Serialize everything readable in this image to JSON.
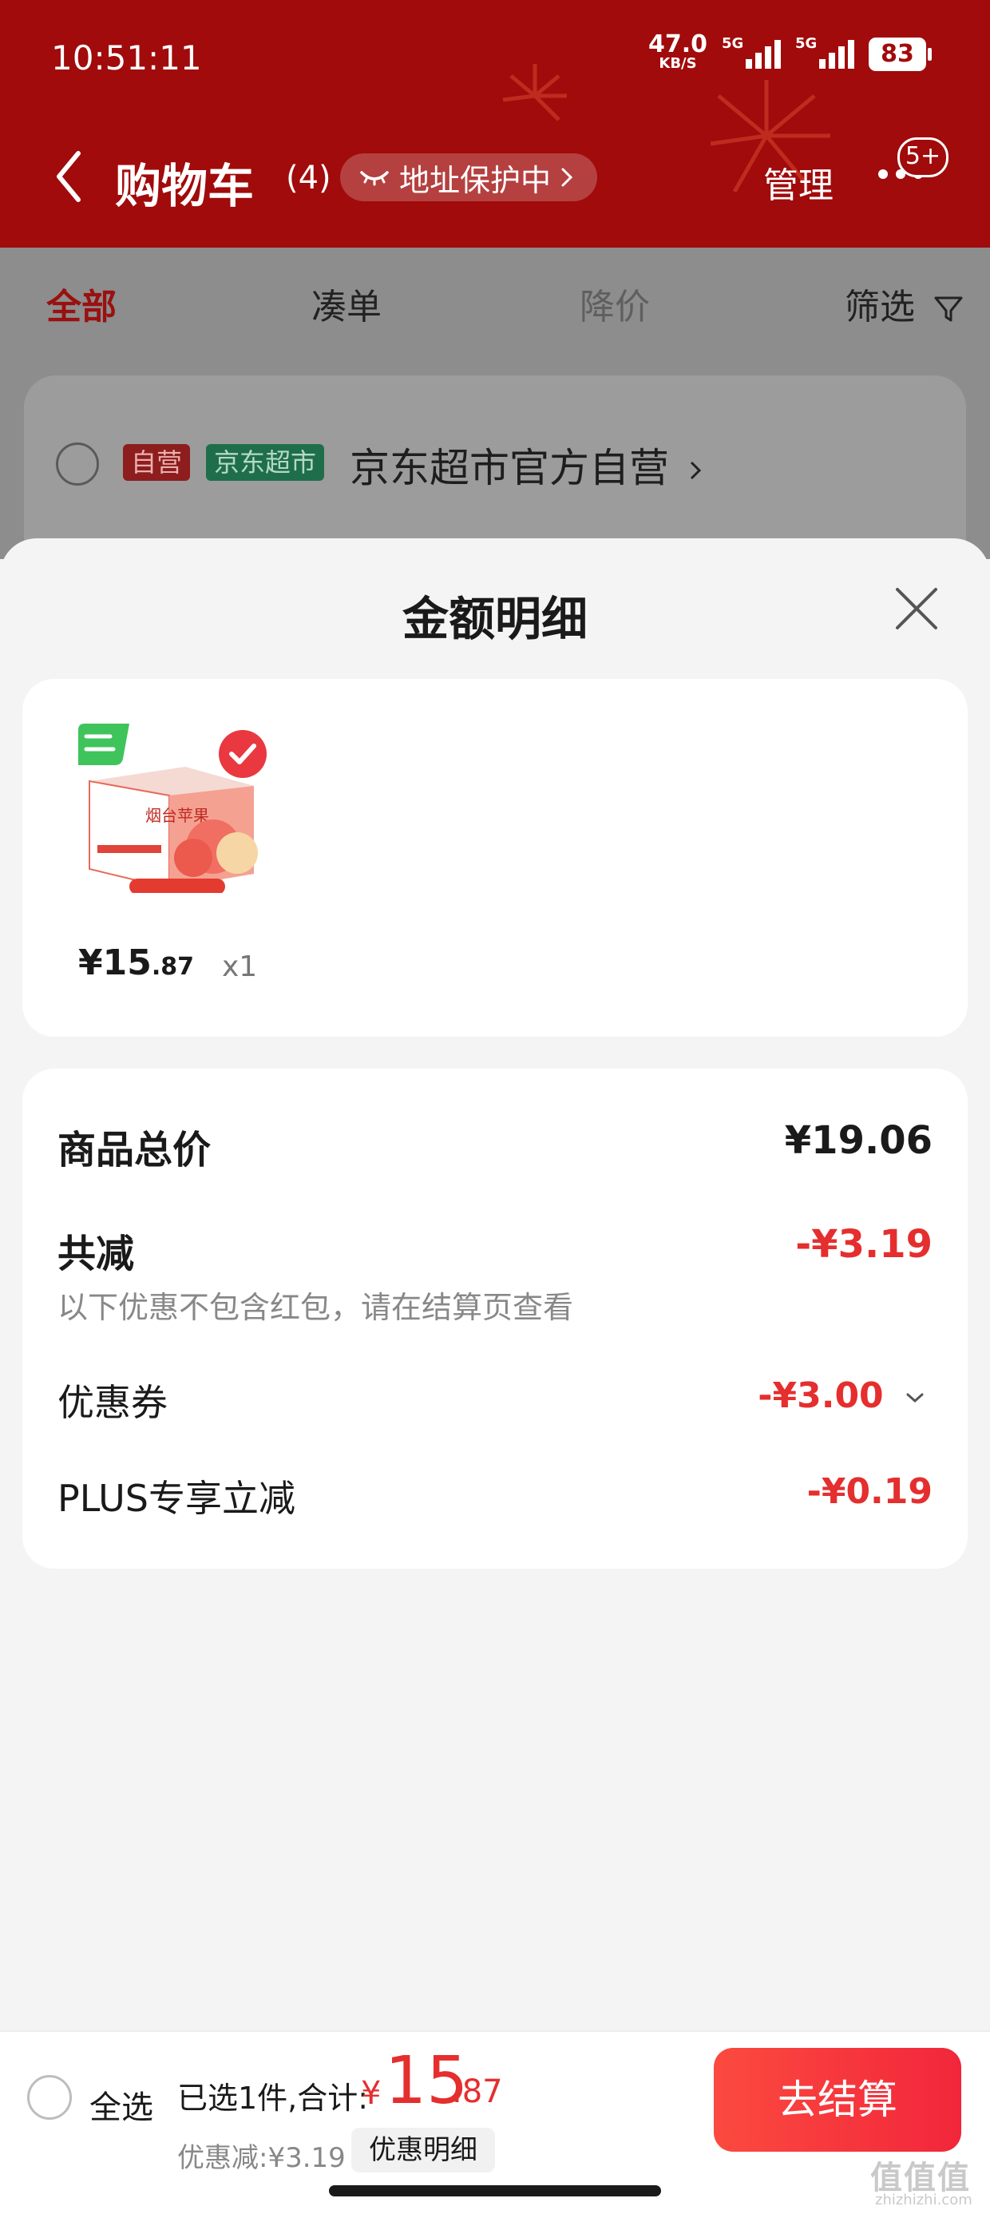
{
  "status_bar": {
    "time": "10:51:11",
    "speed_value": "47.0",
    "speed_unit": "KB/S",
    "signal1_label": "5G",
    "signal2_label": "5G",
    "battery": "83"
  },
  "header": {
    "title": "购物车",
    "count": "(4)",
    "address_pill": "地址保护中",
    "manage": "管理",
    "message_badge": "5+"
  },
  "tabs": [
    {
      "label": "全部",
      "state": "active"
    },
    {
      "label": "凑单",
      "state": "normal"
    },
    {
      "label": "降价",
      "state": "disabled"
    },
    {
      "label": "筛选",
      "state": "normal"
    }
  ],
  "store": {
    "tag_self": "自营",
    "tag_supermarket": "京东超市",
    "name": "京东超市官方自营"
  },
  "sheet": {
    "title": "金额明细",
    "product": {
      "price_symbol": "¥",
      "price_int": "15",
      "price_dec": ".87",
      "quantity": "x1",
      "image_icon": "apple-box-product-image",
      "badge_icon": "free-shipping-badge-icon"
    },
    "summary": {
      "total_label": "商品总价",
      "total_value": "¥19.06",
      "reduce_label": "共减",
      "reduce_value": "-¥3.19",
      "reduce_note": "以下优惠不包含红包，请在结算页查看",
      "coupon_label": "优惠券",
      "coupon_value": "-¥3.00",
      "plus_label": "PLUS专享立减",
      "plus_value": "-¥0.19"
    }
  },
  "bottom_bar": {
    "select_all": "全选",
    "selected_text": "已选1件,合计:",
    "total_symbol": "¥",
    "total_int": "15",
    "total_dec": ".87",
    "discount_text": "优惠减:¥3.19",
    "detail_button": "优惠明细",
    "checkout_button": "去结算"
  },
  "watermark": {
    "text": "值值值",
    "sub": "zhizhizhi.com"
  },
  "colors": {
    "header_red": "#a10b0b",
    "price_red": "#e52e2e",
    "checkout_gradient_start": "#fb4a3f",
    "checkout_gradient_end": "#f2263b"
  }
}
